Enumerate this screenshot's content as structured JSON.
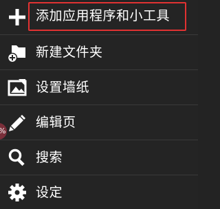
{
  "menu": {
    "items": [
      {
        "label": "添加应用程序和小工具",
        "icon": "plus-icon",
        "highlighted": true
      },
      {
        "label": "新建文件夹",
        "icon": "new-folder-icon"
      },
      {
        "label": "设置墙纸",
        "icon": "wallpaper-icon"
      },
      {
        "label": "编辑页",
        "icon": "pencil-icon"
      },
      {
        "label": "搜索",
        "icon": "search-icon"
      },
      {
        "label": "设定",
        "icon": "gear-icon"
      }
    ]
  },
  "edge_badge": {
    "text": "%"
  },
  "colors": {
    "background": "#242424",
    "text": "#ffffff",
    "highlight_border": "#e23232",
    "divider": "#3a3a3a"
  }
}
